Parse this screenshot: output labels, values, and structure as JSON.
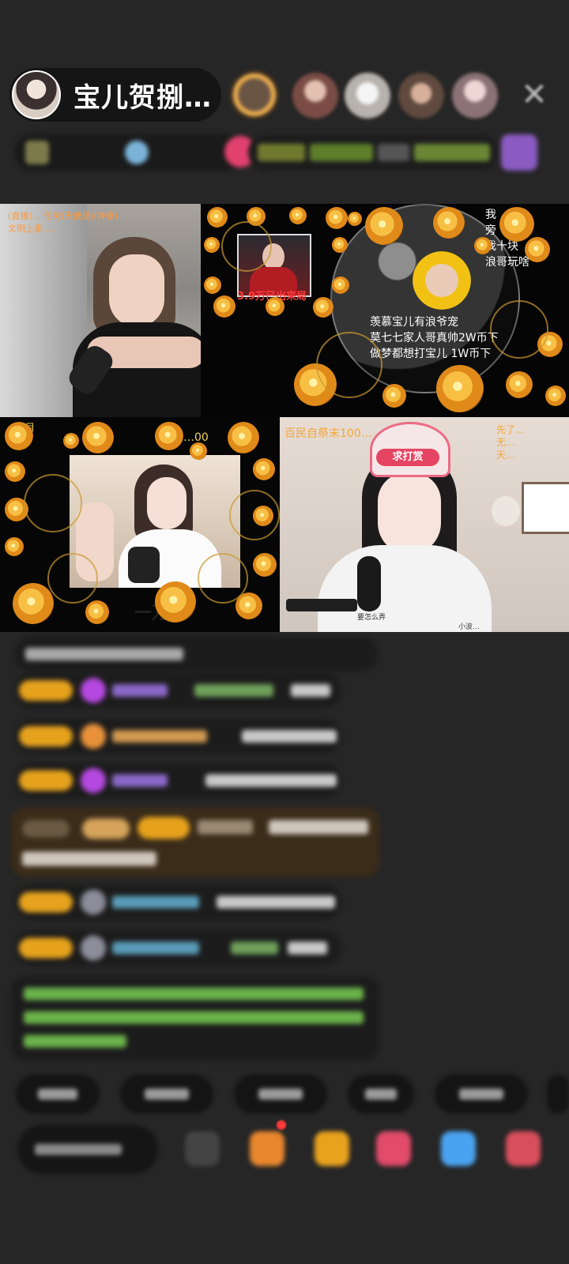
{
  "host": {
    "name": "宝儿贺捌…",
    "avatar_icon": "host-avatar"
  },
  "top_bar": {
    "close_label": "✕",
    "viewer_count": 5
  },
  "video_grid": {
    "tile_1": {
      "caption_line_1": "(直播)… 任务(天使局)(神豪)",
      "caption_line_2": "文明上麦 …"
    },
    "tile_2": {
      "photo_amount": "3.9万已出来局",
      "bubble_lines": [
        "羡慕宝儿有浪爷宠",
        "莫七七家人哥真帅2W币下",
        "做梦都想打宝儿 1W币下"
      ],
      "right_lines": [
        "我",
        "旁",
        "我十块",
        "浪哥玩啥"
      ]
    },
    "tile_3": {
      "caption_top_left": "…合目",
      "caption_top_right": "…00",
      "caption_bottom": "一万"
    },
    "tile_4": {
      "caption_top": "百民自祭末100…",
      "caption_right": [
        "先了…",
        "无…",
        "天…"
      ],
      "hat_label": "求打赏",
      "subtitle_1": "要怎么弄",
      "subtitle_2": "小波…"
    }
  },
  "colors": {
    "background": "#262626",
    "level_badge": "#e6a21c",
    "gift_row": "#3a2c19",
    "notice_text": "#6ab24a",
    "accent_red": "#e2416e"
  }
}
